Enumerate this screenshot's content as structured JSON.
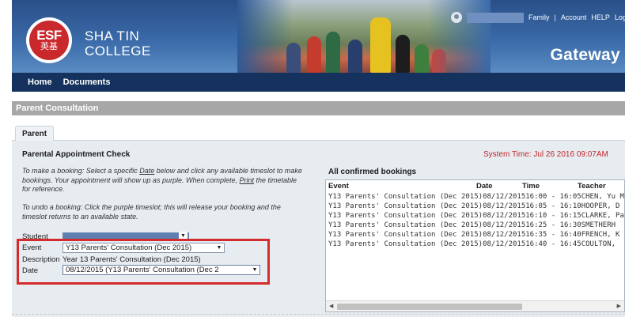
{
  "header": {
    "logo_text": "ESF",
    "logo_chinese": "英基",
    "school_line1": "SHA TIN",
    "school_line2": "COLLEGE",
    "app_name": "Gateway",
    "top_links": [
      "Family",
      "Account",
      "HELP",
      "Logo"
    ],
    "separator": "|"
  },
  "nav": {
    "items": [
      "Home",
      "Documents"
    ]
  },
  "section": {
    "title": "Parent Consultation"
  },
  "tabs": [
    {
      "label": "Parent",
      "active": true
    }
  ],
  "form": {
    "title": "Parental Appointment Check",
    "system_time": "System Time: Jul 26 2016 09:07AM",
    "instructions_1": {
      "before_date": "To make a booking: Select a specific ",
      "date_word": "Date",
      "after_date": " below and click any available timeslot to make bookings. Your appointment will show up as purple. When complete, ",
      "print_word": "Print",
      "after_print": " the timetable for reference."
    },
    "instructions_2": "To undo a booking: Click the purple timeslot; this will release your booking and the timeslot returns to an available state.",
    "student_label": "Student",
    "event_label": "Event",
    "event_value": "Y13 Parents' Consultation (Dec 2015)",
    "description_label": "Description",
    "description_value": "Year 13 Parents' Consultation (Dec 2015)",
    "date_label": "Date",
    "date_value": "08/12/2015 (Y13 Parents' Consultation (Dec 2"
  },
  "bookings": {
    "title": "All confirmed bookings",
    "columns": [
      "Event",
      "Date",
      "Time",
      "Teacher"
    ],
    "rows": [
      "Y13 Parents' Consultation (Dec 2015)08/12/201516:00 - 16:05CHEN, Yu M",
      "Y13 Parents' Consultation (Dec 2015)08/12/201516:05 - 16:10HOOPER, D",
      "Y13 Parents' Consultation (Dec 2015)08/12/201516:10 - 16:15CLARKE, Pa",
      "Y13 Parents' Consultation (Dec 2015)08/12/201516:25 - 16:30SMETHERH",
      "Y13 Parents' Consultation (Dec 2015)08/12/201516:35 - 16:40FRENCH, K",
      "Y13 Parents' Consultation (Dec 2015)08/12/201516:40 - 16:45COULTON,"
    ]
  },
  "colors": {
    "header_blue": "#2a4f88",
    "nav_navy": "#15325e",
    "section_gray": "#a7a7a7",
    "panel_bg": "#e7ecf1",
    "system_time_red": "#c0262b",
    "highlight_red": "#d42c2c"
  },
  "icons": {
    "user": "user-icon",
    "dropdown": "chevron-down-icon"
  }
}
